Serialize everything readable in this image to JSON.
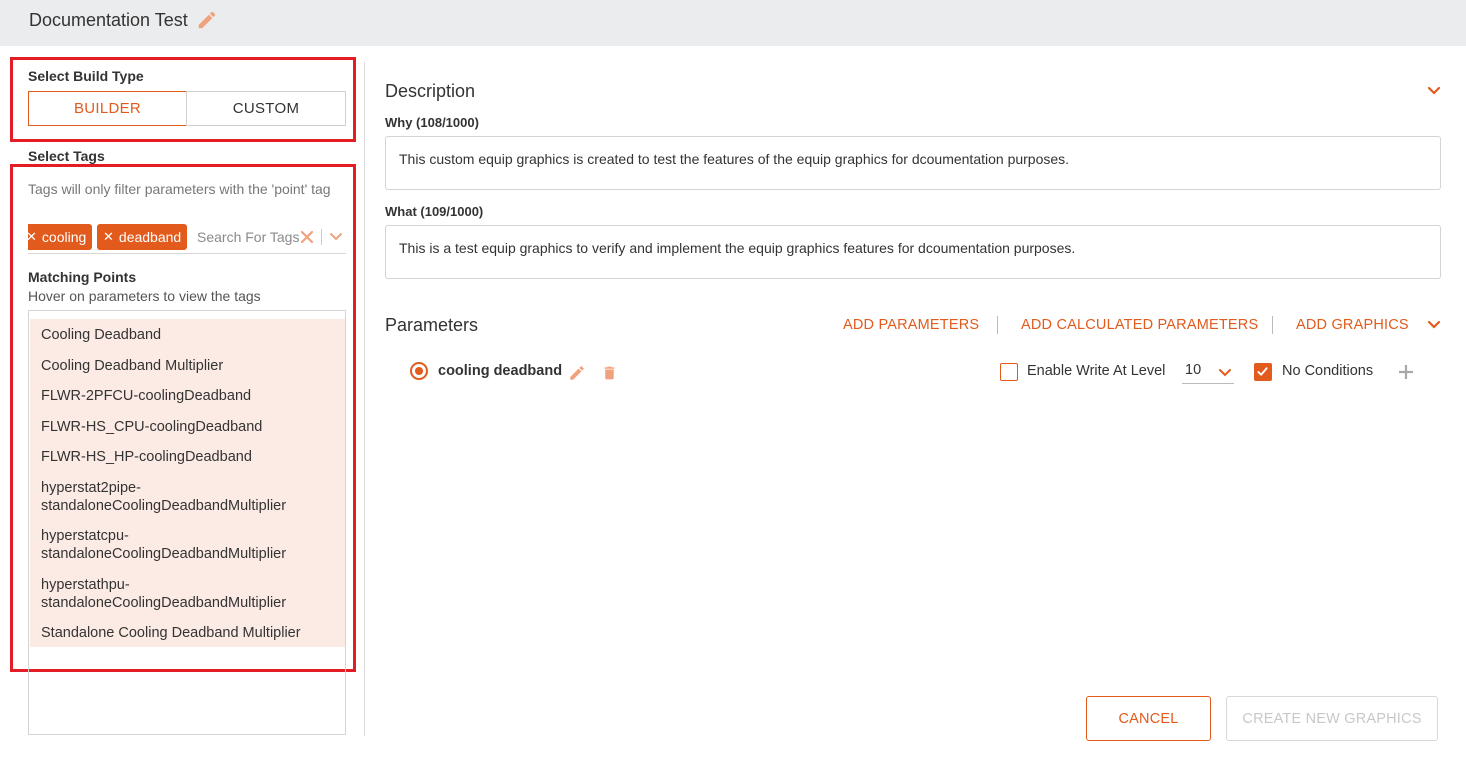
{
  "header": {
    "title": "Documentation Test",
    "edit_icon": "pencil-icon"
  },
  "build_type": {
    "label": "Select Build Type",
    "options": [
      "BUILDER",
      "CUSTOM"
    ],
    "selected": "BUILDER"
  },
  "tags": {
    "label": "Select Tags",
    "note": "Tags will only filter parameters with the 'point' tag",
    "chips": [
      "cooling",
      "deadband"
    ],
    "search_placeholder": "Search For Tags"
  },
  "matching_points": {
    "label": "Matching Points",
    "hint": "Hover on parameters to view the tags",
    "items": [
      "Cooling Deadband",
      "Cooling Deadband Multiplier",
      "FLWR-2PFCU-coolingDeadband",
      "FLWR-HS_CPU-coolingDeadband",
      "FLWR-HS_HP-coolingDeadband",
      "hyperstat2pipe-standaloneCoolingDeadbandMultiplier",
      "hyperstatcpu-standaloneCoolingDeadbandMultiplier",
      "hyperstathpu-standaloneCoolingDeadbandMultiplier",
      "Standalone Cooling Deadband Multiplier"
    ]
  },
  "description": {
    "heading": "Description",
    "why_label": "Why (108/1000)",
    "why_text": "This custom equip graphics is created to test the features of the equip graphics for dcoumentation purposes.",
    "what_label": "What (109/1000)",
    "what_text": "This is a test equip graphics to verify and implement the equip graphics features for dcoumentation purposes."
  },
  "parameters": {
    "heading": "Parameters",
    "actions": {
      "add_parameters": "ADD PARAMETERS",
      "add_calculated": "ADD CALCULATED PARAMETERS",
      "add_graphics": "ADD GRAPHICS"
    },
    "rows": [
      {
        "name": "cooling deadband",
        "enable_write_label": "Enable Write At Level",
        "enable_write_checked": false,
        "level": "10",
        "no_conditions_label": "No Conditions",
        "no_conditions_checked": true
      }
    ]
  },
  "footer": {
    "cancel": "CANCEL",
    "create": "CREATE NEW GRAPHICS"
  },
  "colors": {
    "accent": "#e25a1c",
    "highlight_border": "#e21d26",
    "list_bg": "#fcebe4",
    "header_bg": "#ebecee"
  }
}
